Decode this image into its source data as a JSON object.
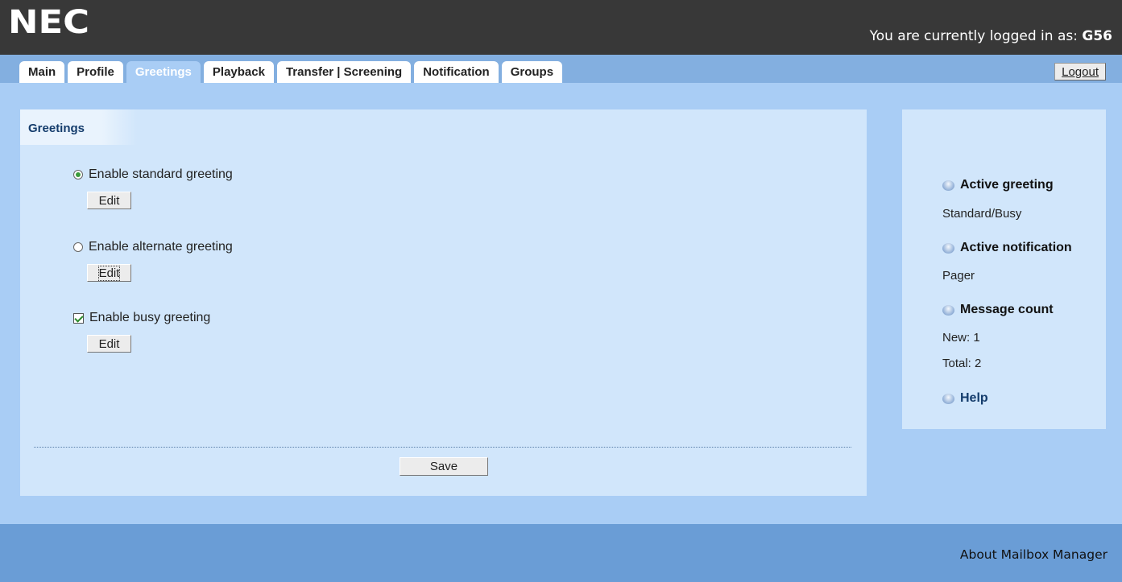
{
  "header": {
    "logo": "NEC",
    "login_prefix": "You are currently logged in as: ",
    "username": "G56"
  },
  "tabs": [
    {
      "label": "Main",
      "active": false
    },
    {
      "label": "Profile",
      "active": false
    },
    {
      "label": "Greetings",
      "active": true
    },
    {
      "label": "Playback",
      "active": false
    },
    {
      "label": "Transfer | Screening",
      "active": false
    },
    {
      "label": "Notification",
      "active": false
    },
    {
      "label": "Groups",
      "active": false
    }
  ],
  "logout_label": "Logout",
  "greetings": {
    "title": "Greetings",
    "options": [
      {
        "label": "Enable standard greeting",
        "control": "radio",
        "checked": true,
        "edit_label": "Edit"
      },
      {
        "label": "Enable alternate greeting",
        "control": "radio",
        "checked": false,
        "edit_label": "Edit"
      },
      {
        "label": "Enable busy greeting",
        "control": "checkbox",
        "checked": true,
        "edit_label": "Edit"
      }
    ],
    "save_label": "Save"
  },
  "sidebar": {
    "active_greeting_title": "Active greeting",
    "active_greeting_value": "Standard/Busy",
    "active_notification_title": "Active notification",
    "active_notification_value": "Pager",
    "message_count_title": "Message count",
    "new_count": "New: 1",
    "total_count": "Total: 2",
    "help_label": "Help"
  },
  "footer": {
    "about_label": "About Mailbox Manager"
  },
  "colors": {
    "header_bg": "#383838",
    "page_bg": "#a9cdf5",
    "panel_bg": "#d1e6fb",
    "tabstrip_bg": "#83afe0",
    "footer_bg": "#6a9dd6",
    "title_blue": "#143c6c"
  }
}
